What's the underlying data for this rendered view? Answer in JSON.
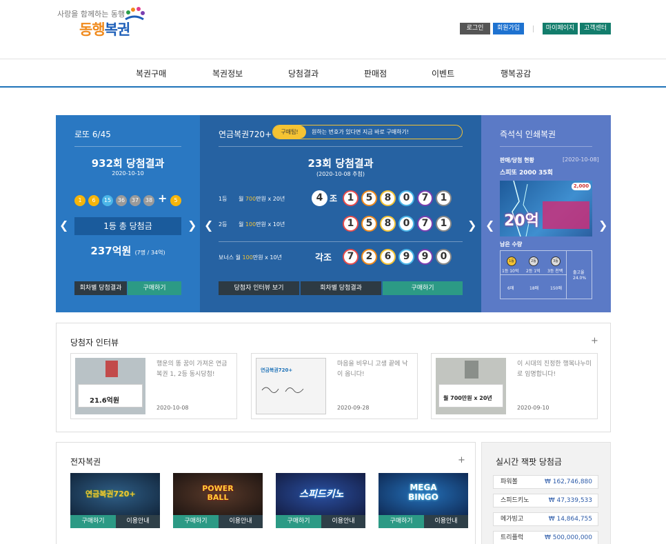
{
  "header": {
    "slogan": "사랑을 함께하는 동행",
    "logo_part1": "동행",
    "logo_part2": "복권",
    "login": "로그인",
    "signup": "회원가입",
    "mypage": "마이페이지",
    "support": "고객센터"
  },
  "nav": [
    "복권구매",
    "복권정보",
    "당첨결과",
    "판매점",
    "이벤트",
    "행복공감"
  ],
  "lotto": {
    "title": "로또 6/45",
    "round": "932회 당첨결과",
    "date": "2020-10-10",
    "numbers": [
      "1",
      "6",
      "15",
      "36",
      "37",
      "38"
    ],
    "plus": "+",
    "bonus": "5",
    "first_prize_label": "1등 총 당첨금",
    "first_prize_amount": "237억원",
    "first_prize_detail": "(7명 / 34억)",
    "btn_history": "회차별 당첨결과",
    "btn_buy": "구매하기"
  },
  "pension": {
    "title": "연금복권720+",
    "tip_badge": "구매팁!",
    "tip_text": "원하는 번호가 있다면 지금 바로 구매하기!",
    "round": "23회 당첨결과",
    "date": "(2020-10-08 추첨)",
    "first_label": "1등",
    "first_desc_pre": "월 ",
    "first_desc_amt": "700",
    "first_desc_post": "만원 x 20년",
    "first_group": "4",
    "first_group_unit": "조",
    "first_numbers": [
      "1",
      "5",
      "8",
      "0",
      "7",
      "1"
    ],
    "second_label": "2등",
    "second_desc_pre": "월 ",
    "second_desc_amt": "100",
    "second_desc_post": "만원 x 10년",
    "second_numbers": [
      "1",
      "5",
      "8",
      "0",
      "7",
      "1"
    ],
    "bonus_label": "보너스",
    "bonus_desc_pre": "월 ",
    "bonus_desc_amt": "100",
    "bonus_desc_post": "만원 x 10년",
    "bonus_group": "각조",
    "bonus_numbers": [
      "7",
      "2",
      "6",
      "9",
      "9",
      "0"
    ],
    "btn_interview": "당첨자 인터뷰 보기",
    "btn_history": "회차별 당첨결과",
    "btn_buy": "구매하기"
  },
  "instant": {
    "title": "즉석식 인쇄복권",
    "status_label": "판매/당첨 현황",
    "status_date": "[2020-10-08]",
    "game_name": "스피또 2000 35회",
    "ticket_price": "2,000",
    "ticket_prize": "20억",
    "remain_label": "남은 수량",
    "col1": "1등 10억",
    "col2": "2등 1억",
    "col3": "3등 천백",
    "ball1": "1등",
    "ball2": "2등",
    "ball3": "3등",
    "count1": "6매",
    "count2": "18매",
    "count3": "150매",
    "release_label": "출고율",
    "release_rate": "24.0%"
  },
  "interview": {
    "title": "당첨자 인터뷰",
    "more": "+",
    "cards": [
      {
        "text": "행운의 똥 꿈이 가져온 연금복권 1, 2등 동시당첨!",
        "date": "2020-10-08",
        "board_big": "21.6억원"
      },
      {
        "text": "마음을 비우니 고생 끝에 낙이 옵니다!",
        "date": "2020-09-28",
        "board_big": "연금복권720+"
      },
      {
        "text": "이 시대의 진정한 행복나누미로 임명합니다!",
        "date": "2020-09-10",
        "board_big": "월 700만원 x 20년"
      }
    ]
  },
  "elotto": {
    "title": "전자복권",
    "more": "+",
    "games": [
      {
        "name": "연금복권720+",
        "buy": "구매하기",
        "info": "이용안내"
      },
      {
        "name": "POWER BALL",
        "buy": "구매하기",
        "info": "이용안내"
      },
      {
        "name": "스피드키노",
        "buy": "구매하기",
        "info": "이용안내"
      },
      {
        "name": "MEGA BINGO",
        "buy": "구매하기",
        "info": "이용안내"
      }
    ]
  },
  "jackpot": {
    "title": "실시간 잭팟 당첨금",
    "currency": "₩",
    "rows": [
      {
        "name": "파워볼",
        "amount": "162,746,880"
      },
      {
        "name": "스피드키노",
        "amount": "47,339,533"
      },
      {
        "name": "메가빙고",
        "amount": "14,864,755"
      },
      {
        "name": "트리플럭",
        "amount": "500,000,000"
      }
    ]
  },
  "colors": {
    "lotto_bg": "#2a78c2",
    "pension_bg": "#2662a2",
    "instant_bg": "#5b7ac6",
    "accent_orange": "#f08a1c",
    "accent_blue": "#1e72b8"
  }
}
